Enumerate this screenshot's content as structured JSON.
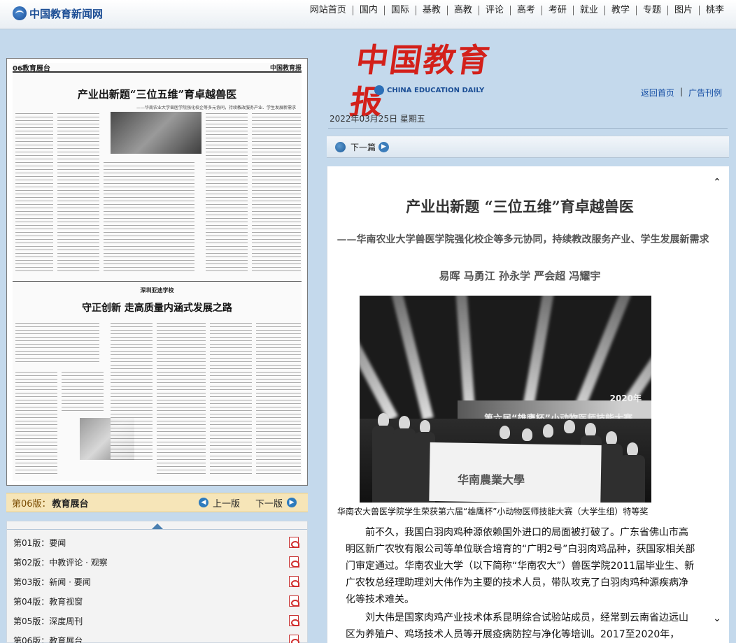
{
  "site": {
    "logo_text": "中国教育新闻网",
    "nav": [
      "网站首页",
      "国内",
      "国际",
      "基教",
      "高教",
      "评论",
      "高考",
      "考研",
      "就业",
      "教学",
      "专题",
      "图片",
      "桃李"
    ]
  },
  "paper_preview": {
    "edition_label": "06教育展台",
    "masthead": "中国教育报",
    "headline": "产业出新题“三位五维”育卓越兽医",
    "subheadline": "——华南农业大学兽医学院强化校企等多元协同，持续教改服务产业、学生发展新需求",
    "school_label": "深圳亚迪学校",
    "headline2": "守正创新 走高质量内涵式发展之路"
  },
  "edition_bar": {
    "current_label": "第06版：",
    "current_name": "教育展台",
    "prev_label": "上一版",
    "next_label": "下一版"
  },
  "pages": [
    {
      "label": "第01版：要闻"
    },
    {
      "label": "第02版：中教评论 · 观察"
    },
    {
      "label": "第03版：新闻 · 要闻"
    },
    {
      "label": "第04版：教育视窗"
    },
    {
      "label": "第05版：深度周刊"
    },
    {
      "label": "第06版：教育展台"
    }
  ],
  "masthead": {
    "title": "中国教育报",
    "english": "CHINA EDUCATION DAILY"
  },
  "top_links": {
    "home": "返回首页",
    "ads": "广告刊例",
    "separator": "|"
  },
  "date": "2022年03月25日 星期五",
  "article_nav": {
    "next": "下一篇"
  },
  "article": {
    "title": "产业出新题 “三位五维”育卓越兽医",
    "subtitle": "——华南农业大学兽医学院强化校企等多元协同，持续教改服务产业、学生发展新需求",
    "authors": "易晖 马勇江 孙永学 严会超 冯耀宇",
    "photo_screen_year": "2020年",
    "photo_screen_title": "第六届“雄鹰杯”小动物医师技能大赛",
    "photo_banner": "华南農業大學",
    "caption": "华南农大兽医学院学生荣获第六届“雄鹰杯”小动物医师技能大赛（大学生组）特等奖",
    "paragraphs": [
      "前不久，我国白羽肉鸡种源依赖国外进口的局面被打破了。广东省佛山市高明区新广农牧有限公司等单位联合培育的“广明2号”白羽肉鸡品种，获国家相关部门审定通过。华南农业大学（以下简称“华南农大”）兽医学院2011届毕业生、新广农牧总经理助理刘大伟作为主要的技术人员，带队攻克了白羽肉鸡种源疾病净化等技术难关。",
      "刘大伟是国家肉鸡产业技术体系昆明综合试验站成员，经常到云南省边远山区为养殖户、鸡场技术人员等开展疫病防控与净化等培训。2017至2020年，"
    ]
  }
}
